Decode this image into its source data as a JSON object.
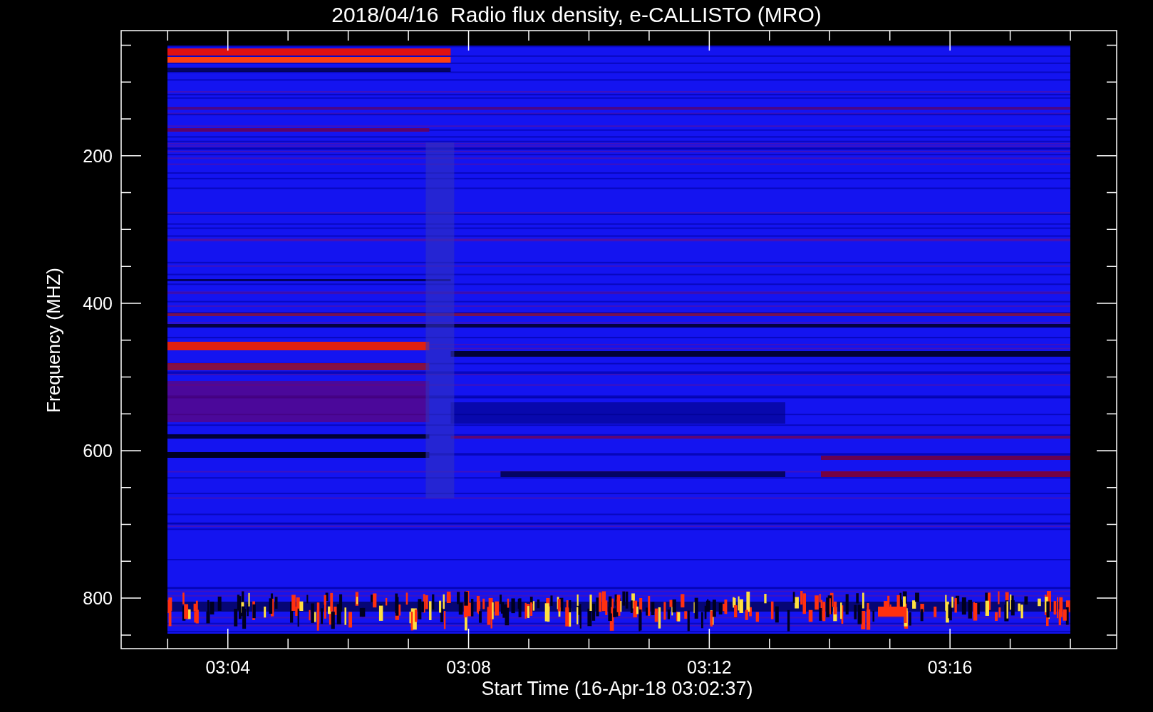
{
  "title": "2018/04/16  Radio flux density, e-CALLISTO (MRO)",
  "y_axis": {
    "label": "Frequency (MHZ)",
    "ticks": [
      "200",
      "400",
      "600",
      "800"
    ]
  },
  "x_axis": {
    "label": "Start Time (16-Apr-18 03:02:37)",
    "ticks": [
      "03:04",
      "03:08",
      "03:12",
      "03:16"
    ]
  }
}
